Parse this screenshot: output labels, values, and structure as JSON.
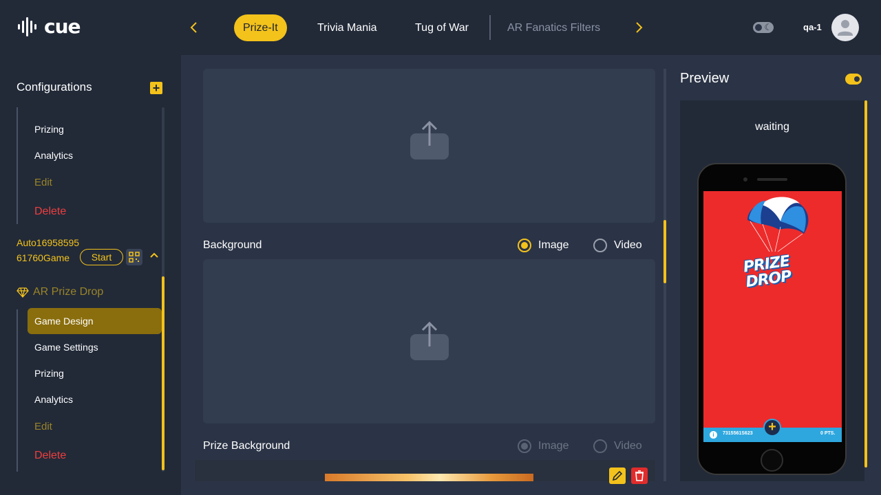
{
  "header": {
    "logo_text": "cue",
    "tabs": [
      {
        "label": "Prize-It",
        "active": true
      },
      {
        "label": "Trivia Mania",
        "active": false
      },
      {
        "label": "Tug of War",
        "active": false
      },
      {
        "label": "AR Fanatics Filters",
        "active": false
      }
    ],
    "prev_icon": "chevron-left-icon",
    "next_icon": "chevron-right-icon",
    "theme_toggle_icon": "moon-icon",
    "user_name": "qa-1",
    "avatar_icon": "user-avatar-icon"
  },
  "sidebar": {
    "title": "Configurations",
    "add_icon": "plus-icon",
    "upper_items": {
      "prizing": "Prizing",
      "analytics": "Analytics",
      "edit": "Edit",
      "delete": "Delete"
    },
    "game": {
      "name": "Auto1695859561760Game",
      "start_label": "Start",
      "qr_icon": "qr-code-icon",
      "collapse_icon": "chevron-up-icon",
      "type_icon": "gem-icon",
      "type_label": "AR Prize Drop",
      "items": {
        "game_design": "Game Design",
        "game_settings": "Game Settings",
        "prizing": "Prizing",
        "analytics": "Analytics",
        "edit": "Edit",
        "delete": "Delete"
      }
    }
  },
  "main": {
    "upload_icon": "upload-icon",
    "background": {
      "label": "Background",
      "options": [
        {
          "label": "Image",
          "selected": true
        },
        {
          "label": "Video",
          "selected": false
        }
      ]
    },
    "prize_background": {
      "label": "Prize Background",
      "disabled": true,
      "options": [
        {
          "label": "Image",
          "selected": true
        },
        {
          "label": "Video",
          "selected": false
        }
      ]
    },
    "edit_icon": "pencil-icon",
    "delete_icon": "trash-icon"
  },
  "preview": {
    "title": "Preview",
    "toggle_on": true,
    "status": "waiting",
    "game_logo_line1": "PRIZE",
    "game_logo_line2": "DROP",
    "footer_id": "7315561S623",
    "footer_points": "0 PTS.",
    "accent_color": "#f3c21b",
    "screen_color": "#ed2b2b"
  }
}
